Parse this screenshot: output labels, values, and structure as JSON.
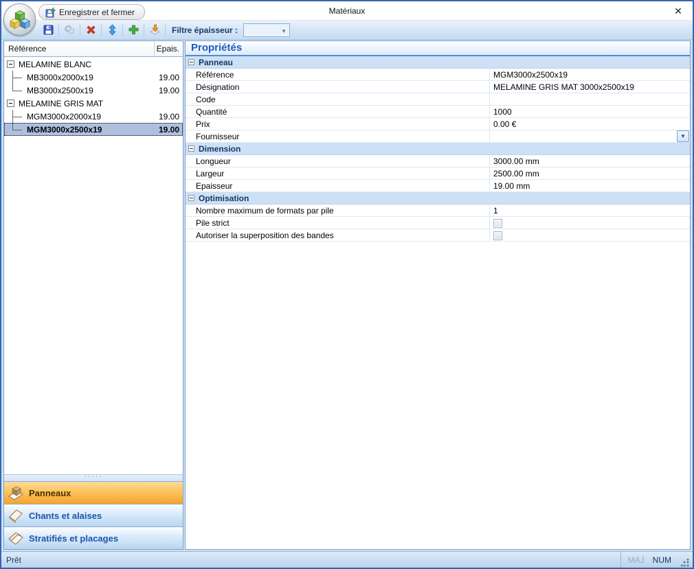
{
  "window": {
    "title": "Matériaux",
    "close_glyph": "✕"
  },
  "header": {
    "save_close_label": "Enregistrer et fermer"
  },
  "toolbar": {
    "filter_label": "Filtre épaisseur :",
    "filter_value": "",
    "icons": [
      "save-icon",
      "link-icon",
      "delete-icon",
      "move-up-down-icon",
      "add-icon",
      "import-icon"
    ]
  },
  "tree": {
    "columns": {
      "reference": "Référence",
      "thickness": "Epais."
    },
    "groups": [
      {
        "label": "MELAMINE BLANC",
        "items": [
          {
            "ref": "MB3000x2000x19",
            "epais": "19.00"
          },
          {
            "ref": "MB3000x2500x19",
            "epais": "19.00"
          }
        ]
      },
      {
        "label": "MELAMINE GRIS MAT",
        "items": [
          {
            "ref": "MGM3000x2000x19",
            "epais": "19.00"
          },
          {
            "ref": "MGM3000x2500x19",
            "epais": "19.00"
          }
        ]
      }
    ],
    "selected_item": "MGM3000x2500x19"
  },
  "nav": {
    "items": [
      {
        "label": "Panneaux",
        "active": true
      },
      {
        "label": "Chants et alaises",
        "active": false
      },
      {
        "label": "Stratifiés et placages",
        "active": false
      }
    ]
  },
  "properties": {
    "title": "Propriétés",
    "sections": [
      {
        "label": "Panneau",
        "rows": [
          {
            "label": "Référence",
            "value": "MGM3000x2500x19"
          },
          {
            "label": "Désignation",
            "value": "MELAMINE GRIS MAT 3000x2500x19"
          },
          {
            "label": "Code",
            "value": ""
          },
          {
            "label": "Quantité",
            "value": "1000"
          },
          {
            "label": "Prix",
            "value": "0.00 €"
          },
          {
            "label": "Fournisseur",
            "value": "",
            "control": "dropdown"
          }
        ]
      },
      {
        "label": "Dimension",
        "rows": [
          {
            "label": "Longueur",
            "value": "3000.00 mm"
          },
          {
            "label": "Largeur",
            "value": "2500.00 mm"
          },
          {
            "label": "Epaisseur",
            "value": "19.00 mm"
          }
        ]
      },
      {
        "label": "Optimisation",
        "rows": [
          {
            "label": "Nombre maximum de formats par pile",
            "value": "1"
          },
          {
            "label": "Pile strict",
            "value": "",
            "control": "checkbox",
            "checked": false
          },
          {
            "label": "Autoriser la superposition des bandes",
            "value": "",
            "control": "checkbox",
            "checked": false
          }
        ]
      }
    ]
  },
  "statusbar": {
    "status": "Prêt",
    "maj": "MAJ",
    "num": "NUM"
  },
  "colors": {
    "window_border": "#3565ae",
    "selection_blue": "#aec0de",
    "nav_active_orange": "#f6a42e",
    "properties_title_blue": "#1a5dc4",
    "section_header_bg": "#cde1f6"
  }
}
